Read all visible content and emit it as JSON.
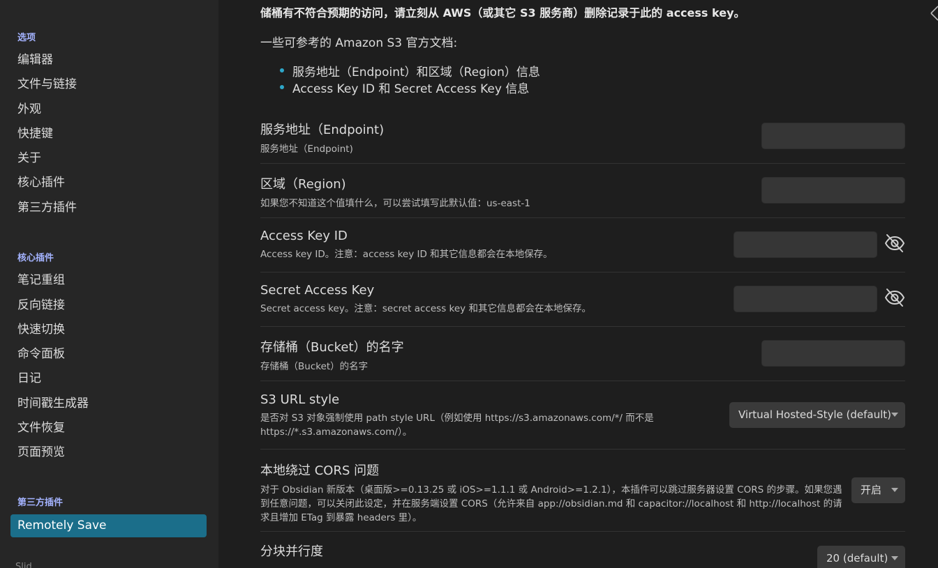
{
  "sidebar": {
    "options_title": "选项",
    "options": [
      "编辑器",
      "文件与链接",
      "外观",
      "快捷键",
      "关于",
      "核心插件",
      "第三方插件"
    ],
    "core_title": "核心插件",
    "core": [
      "笔记重组",
      "反向链接",
      "快速切换",
      "命令面板",
      "日记",
      "时间戳生成器",
      "文件恢复",
      "页面预览"
    ],
    "third_title": "第三方插件",
    "active": "Remotely Save",
    "cut_text": "Slid..."
  },
  "main": {
    "warning": "储桶有不符合预期的访问，请立刻从 AWS（或其它 S3 服务商）删除记录于此的 access key。",
    "docs_intro": "一些可参考的 Amazon S3 官方文档:",
    "doc_links": [
      "服务地址（Endpoint）和区域（Region）信息",
      "Access Key ID 和 Secret Access Key 信息"
    ],
    "settings": {
      "endpoint": {
        "name": "服务地址（Endpoint)",
        "desc": "服务地址（Endpoint)"
      },
      "region": {
        "name": "区域（Region)",
        "desc": "如果您不知道这个值填什么，可以尝试填写此默认值：us-east-1"
      },
      "access_key_id": {
        "name": "Access Key ID",
        "desc": "Access key ID。注意：access key ID 和其它信息都会在本地保存。"
      },
      "secret_access_key": {
        "name": "Secret Access Key",
        "desc": "Secret access key。注意：secret access key 和其它信息都会在本地保存。"
      },
      "bucket": {
        "name": "存储桶（Bucket）的名字",
        "desc": "存储桶（Bucket）的名字"
      },
      "url_style": {
        "name": "S3 URL style",
        "desc": "是否对 S3 对象强制使用 path style URL（例如使用 https://s3.amazonaws.com/*/ 而不是 https://*.s3.amazonaws.com/）。",
        "value": "Virtual Hosted-Style (default)"
      },
      "cors": {
        "name": "本地绕过 CORS 问题",
        "desc": "对于 Obsidian 新版本（桌面版>=0.13.25 或 iOS>=1.1.1 或 Android>=1.2.1），本插件可以跳过服务器设置 CORS 的步骤。如果您遇到任意问题，可以关闭此设定，并在服务端设置 CORS（允许来自 app://obsidian.md 和 capacitor://localhost 和 http://localhost 的请求且增加 ETag 到暴露 headers 里）。",
        "value": "开启"
      },
      "parallel": {
        "name": "分块并行度",
        "value": "20 (default)"
      }
    }
  },
  "colors": {
    "accent": "#1b6e8a",
    "group_title": "#a4b3ff",
    "bullet": "#2ea7c9"
  }
}
